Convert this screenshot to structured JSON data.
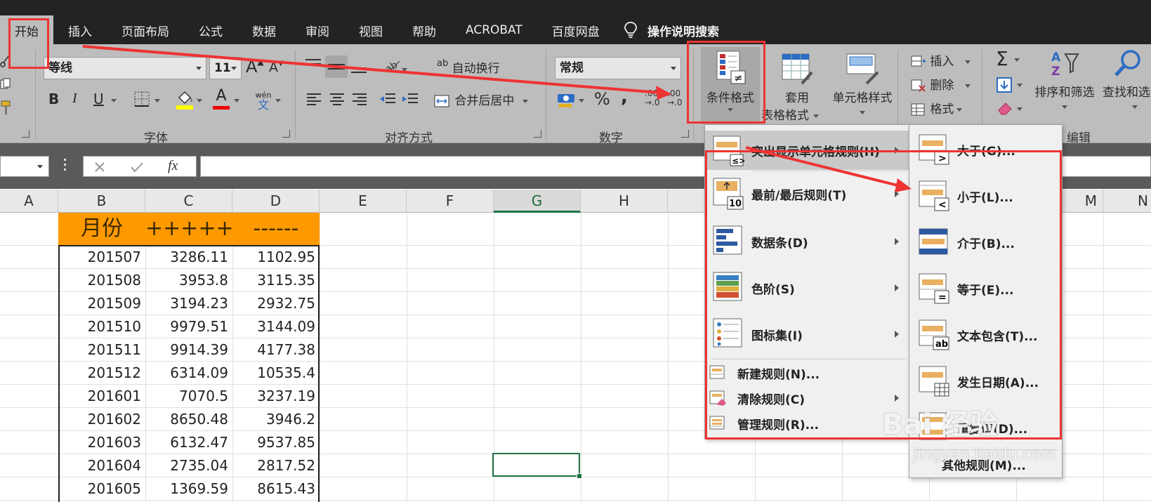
{
  "tabs": [
    "开始",
    "插入",
    "页面布局",
    "公式",
    "数据",
    "审阅",
    "视图",
    "帮助",
    "ACROBAT",
    "百度网盘"
  ],
  "tell_me": "操作说明搜索",
  "ribbon": {
    "font_name": "等线",
    "font_size": "11",
    "bold": "B",
    "italic": "I",
    "underline": "U",
    "grow_font": "A",
    "shrink_font": "A",
    "font_color_glyph": "A",
    "phonetic_top": "wén",
    "phonetic_bottom": "文",
    "wrap_icon_label": "ab",
    "wrap_text": "自动换行",
    "merge_center": "合并后居中",
    "number_format": "常规",
    "percent": "%",
    "comma": ",",
    "dec_inc_top": ".00",
    "dec_inc_bottom": "→.0",
    "dec_dec_top": ".00",
    "dec_dec_bottom": "→.0",
    "cond_format": "条件格式",
    "table_format_1": "套用",
    "table_format_2": "表格格式",
    "cell_styles": "单元格样式",
    "insert": "插入",
    "delete": "删除",
    "format": "格式",
    "sum": "Σ",
    "sort_filter": "排序和筛选",
    "find_select": "查找和选",
    "group_font": "字体",
    "group_align": "对齐方式",
    "group_number": "数字",
    "group_edit": "编辑"
  },
  "formula_bar": {
    "fx": "fx"
  },
  "columns": [
    "A",
    "B",
    "C",
    "D",
    "E",
    "F",
    "G",
    "H",
    "M",
    "N"
  ],
  "table": {
    "headers": [
      "月份",
      "+++++",
      "------"
    ],
    "rows": [
      [
        "201507",
        "3286.11",
        "1102.95"
      ],
      [
        "201508",
        "3953.8",
        "3115.35"
      ],
      [
        "201509",
        "3194.23",
        "2932.75"
      ],
      [
        "201510",
        "9979.51",
        "3144.09"
      ],
      [
        "201511",
        "9914.39",
        "4177.38"
      ],
      [
        "201512",
        "6314.09",
        "10535.4"
      ],
      [
        "201601",
        "7070.5",
        "3237.19"
      ],
      [
        "201602",
        "8650.48",
        "3946.2"
      ],
      [
        "201603",
        "6132.47",
        "9537.85"
      ],
      [
        "201604",
        "2735.04",
        "2817.52"
      ],
      [
        "201605",
        "1369.59",
        "8615.43"
      ]
    ]
  },
  "cf_menu": {
    "items": [
      {
        "label": "突出显示单元格规则(H)",
        "submenu": true
      },
      {
        "label": "最前/最后规则(T)",
        "submenu": true
      },
      {
        "label": "数据条(D)",
        "submenu": true
      },
      {
        "label": "色阶(S)",
        "submenu": true
      },
      {
        "label": "图标集(I)",
        "submenu": true
      },
      {
        "label": "新建规则(N)...",
        "submenu": false
      },
      {
        "label": "清除规则(C)",
        "submenu": true
      },
      {
        "label": "管理规则(R)...",
        "submenu": false
      }
    ]
  },
  "highlight_menu": {
    "items": [
      {
        "label": "大于(G)...",
        "icon": ">"
      },
      {
        "label": "小于(L)...",
        "icon": "<"
      },
      {
        "label": "介于(B)...",
        "icon": ""
      },
      {
        "label": "等于(E)...",
        "icon": "="
      },
      {
        "label": "文本包含(T)...",
        "icon": "ab"
      },
      {
        "label": "发生日期(A)...",
        "icon": ""
      },
      {
        "label": "重复值(D)...",
        "icon": ""
      },
      {
        "label": "其他规则(M)...",
        "icon": ""
      }
    ]
  },
  "watermark": {
    "main": "Bai 经验",
    "sub": "jingyan.baidu.com"
  },
  "colors": {
    "header_orange": "#ff9900",
    "ribbon_gray": "#bdbdbd",
    "annotation_red": "#ee3333",
    "selection_green": "#217346"
  }
}
